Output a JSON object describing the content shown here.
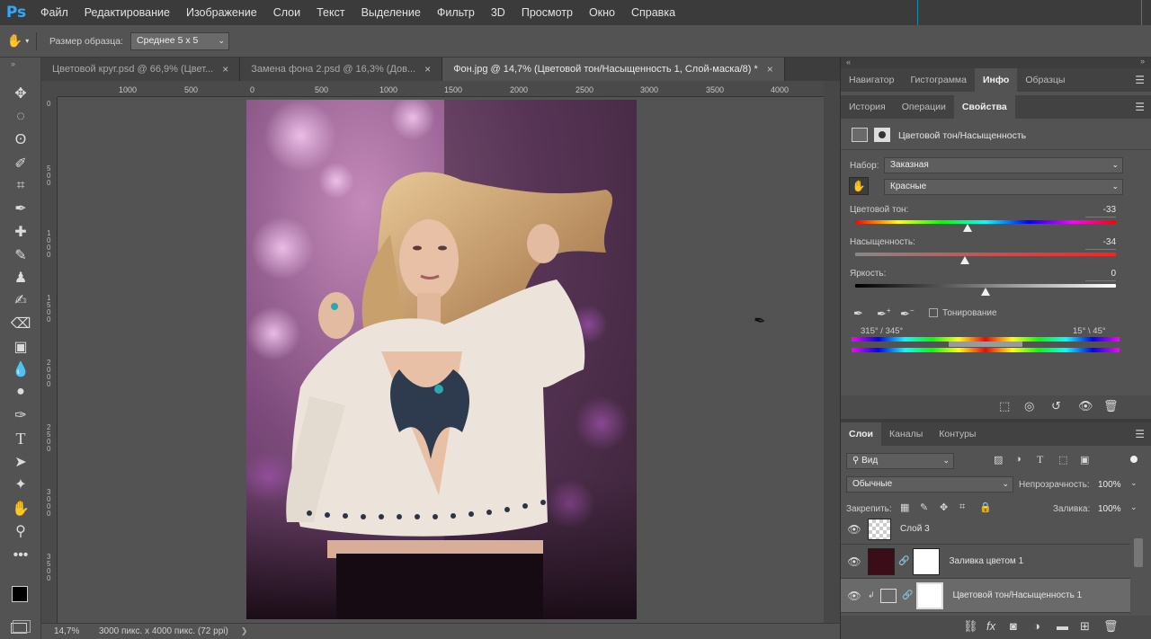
{
  "app": {
    "logo": "Ps"
  },
  "menu": [
    "Файл",
    "Редактирование",
    "Изображение",
    "Слои",
    "Текст",
    "Выделение",
    "Фильтр",
    "3D",
    "Просмотр",
    "Окно",
    "Справка"
  ],
  "options": {
    "sample_label": "Размер образца:",
    "sample_value": "Среднее 5 х 5"
  },
  "tabs": [
    {
      "label": "Цветовой круг.psd @ 66,9% (Цвет...",
      "close": "×"
    },
    {
      "label": "Замена фона 2.psd @ 16,3% (Дов...",
      "close": "×"
    },
    {
      "label": "Фон.jpg @ 14,7% (Цветовой тон/Насыщенность 1, Слой-маска/8) *",
      "close": "×",
      "active": true
    }
  ],
  "ruler": {
    "h": [
      "1000",
      "500",
      "0",
      "500",
      "1000",
      "1500",
      "2000",
      "2500",
      "3000",
      "3500",
      "4000"
    ],
    "v": [
      "0",
      "5 0 0",
      "1 0 0 0",
      "1 5 0 0",
      "2 0 0 0",
      "2 5 0 0",
      "3 0 0 0",
      "3 5 0 0"
    ]
  },
  "status": {
    "zoom": "14,7%",
    "info": "3000 пикс. х 4000 пикс. (72 ppi)",
    "arrow": "❯"
  },
  "top_panel_tabs": [
    {
      "label": "Навигатор"
    },
    {
      "label": "Гистограмма"
    },
    {
      "label": "Инфо",
      "active": true
    },
    {
      "label": "Образцы"
    }
  ],
  "mid_panel_tabs": [
    {
      "label": "История"
    },
    {
      "label": "Операции"
    },
    {
      "label": "Свойства",
      "active": true
    }
  ],
  "properties": {
    "title": "Цветовой тон/Насыщенность",
    "preset_label": "Набор:",
    "preset_value": "Заказная",
    "channel_value": "Красные",
    "hue_label": "Цветовой тон:",
    "hue_value": "-33",
    "hue_fraction": 0.43,
    "sat_label": "Насыщенность:",
    "sat_value": "-34",
    "sat_fraction": 0.42,
    "light_label": "Яркость:",
    "light_value": "0",
    "light_fraction": 0.5,
    "colorize_label": "Тонирование",
    "range_left": "315° / 345°",
    "range_right": "15° \\ 45°"
  },
  "layers_tabs": [
    {
      "label": "Слои",
      "active": true
    },
    {
      "label": "Каналы"
    },
    {
      "label": "Контуры"
    }
  ],
  "layers_panel": {
    "filter_value": "Вид",
    "blend_value": "Обычные",
    "opacity_label": "Непрозрачность:",
    "opacity_value": "100%",
    "lock_label": "Закрепить:",
    "fill_label": "Заливка:",
    "fill_value": "100%",
    "layers": [
      {
        "name": "Слой 3",
        "thumb": "checker"
      },
      {
        "name": "Заливка цветом 1",
        "thumb": "#3a0d18",
        "mask": true
      },
      {
        "name": "Цветовой тон/Насыщенность 1",
        "thumb": "adjust",
        "mask": true,
        "selected": true,
        "clipped": true
      }
    ]
  },
  "colors": {
    "accent": "#31a8ff",
    "fg": "#000000",
    "bg": "#ffffff"
  }
}
